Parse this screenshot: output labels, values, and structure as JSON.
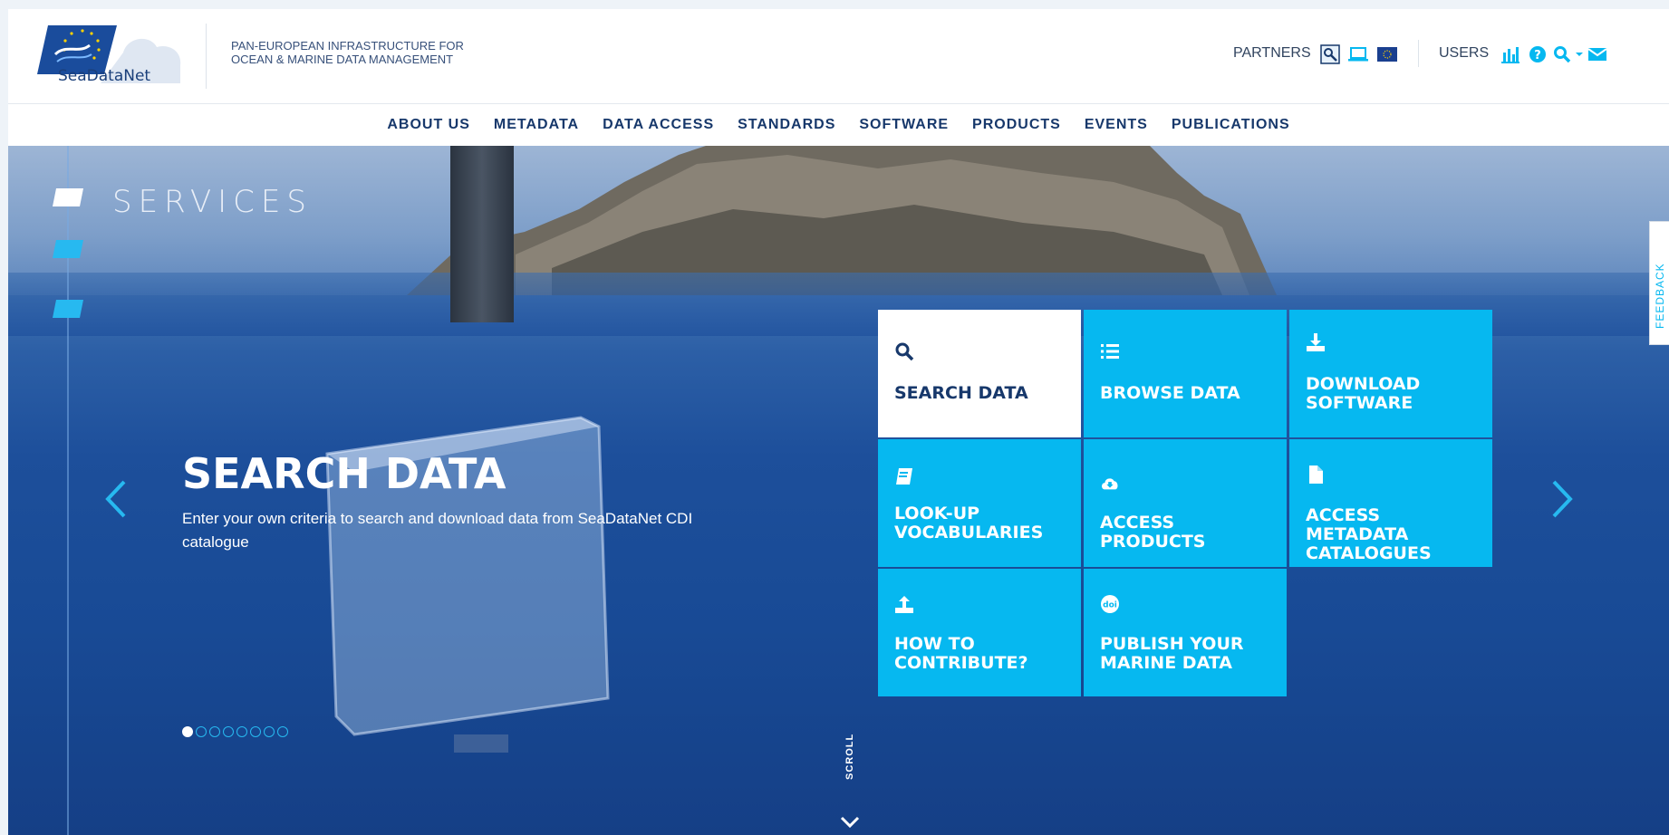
{
  "header": {
    "logo_text": "SeaDataNet",
    "tagline_line1": "PAN-EUROPEAN INFRASTRUCTURE FOR",
    "tagline_line2": "OCEAN & MARINE DATA MANAGEMENT",
    "partners_label": "PARTNERS",
    "users_label": "USERS"
  },
  "nav": {
    "items": [
      "ABOUT US",
      "METADATA",
      "DATA ACCESS",
      "STANDARDS",
      "SOFTWARE",
      "PRODUCTS",
      "EVENTS",
      "PUBLICATIONS"
    ]
  },
  "hero": {
    "section_label": "SERVICES",
    "title": "SEARCH DATA",
    "description": "Enter your own criteria to search and download data from SeaDataNet CDI catalogue",
    "scroll_label": "SCROLL",
    "slides": {
      "count": 8,
      "active": 0
    }
  },
  "tiles": [
    {
      "line1": "SEARCH DATA",
      "line2": "",
      "icon": "search-icon",
      "active": true
    },
    {
      "line1": "BROWSE DATA",
      "line2": "",
      "icon": "list-icon",
      "active": false
    },
    {
      "line1": "DOWNLOAD",
      "line2": "SOFTWARE",
      "icon": "download-icon",
      "active": false
    },
    {
      "line1": "LOOK-UP",
      "line2": "VOCABULARIES",
      "icon": "book-icon",
      "active": false
    },
    {
      "line1": "ACCESS PRODUCTS",
      "line2": "",
      "icon": "cloud-download-icon",
      "active": false
    },
    {
      "line1": "ACCESS METADATA",
      "line2": "CATALOGUES",
      "icon": "file-icon",
      "active": false
    },
    {
      "line1": "HOW TO",
      "line2": "CONTRIBUTE?",
      "icon": "upload-icon",
      "active": false
    },
    {
      "line1": "PUBLISH YOUR",
      "line2": "MARINE DATA",
      "icon": "doi-icon",
      "active": false
    }
  ],
  "feedback_label": "FEEDBACK",
  "colors": {
    "accent": "#06b8f0",
    "navy": "#17386b"
  }
}
